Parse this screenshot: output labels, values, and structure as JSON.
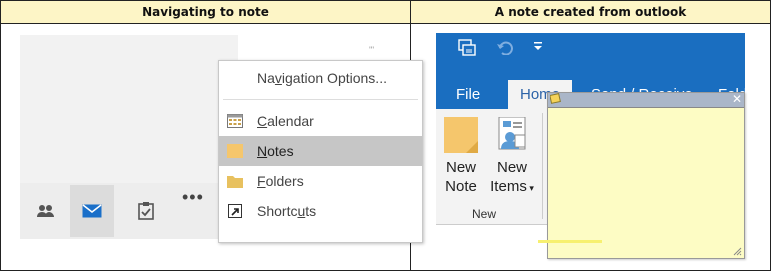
{
  "headers": {
    "left": "Navigating to note",
    "right": "A note created from outlook"
  },
  "left": {
    "menu": {
      "title_pre": "Na",
      "title_u": "v",
      "title_post": "igation Options...",
      "items": [
        {
          "pre": "",
          "u": "C",
          "post": "alendar",
          "icon": "calendar-icon",
          "selected": false
        },
        {
          "pre": "",
          "u": "N",
          "post": "otes",
          "icon": "notes-icon",
          "selected": true
        },
        {
          "pre": "",
          "u": "F",
          "post": "olders",
          "icon": "folder-icon",
          "selected": false
        },
        {
          "pre": "Shortc",
          "u": "u",
          "post": "ts",
          "icon": "shortcut-icon",
          "selected": false
        }
      ]
    },
    "bottom_nav": [
      "people-icon",
      "mail-icon",
      "tasks-icon",
      "more-icon"
    ],
    "more_label": "•••"
  },
  "right": {
    "tabs": {
      "file": "File",
      "home": "Home",
      "send_receive": "Send / Receive",
      "folder_partial": "Fold"
    },
    "ribbon": {
      "new_note_line1": "New",
      "new_note_line2": "Note",
      "new_items_line1": "New",
      "new_items_line2": "Items",
      "group_label": "New"
    },
    "note": {
      "close_glyph": "✕",
      "color": "#fdfcc4"
    }
  },
  "colors": {
    "header_bg": "#fdf5c6",
    "ribbon_blue": "#1a6ec0",
    "selection_gray": "#c6c6c6"
  }
}
